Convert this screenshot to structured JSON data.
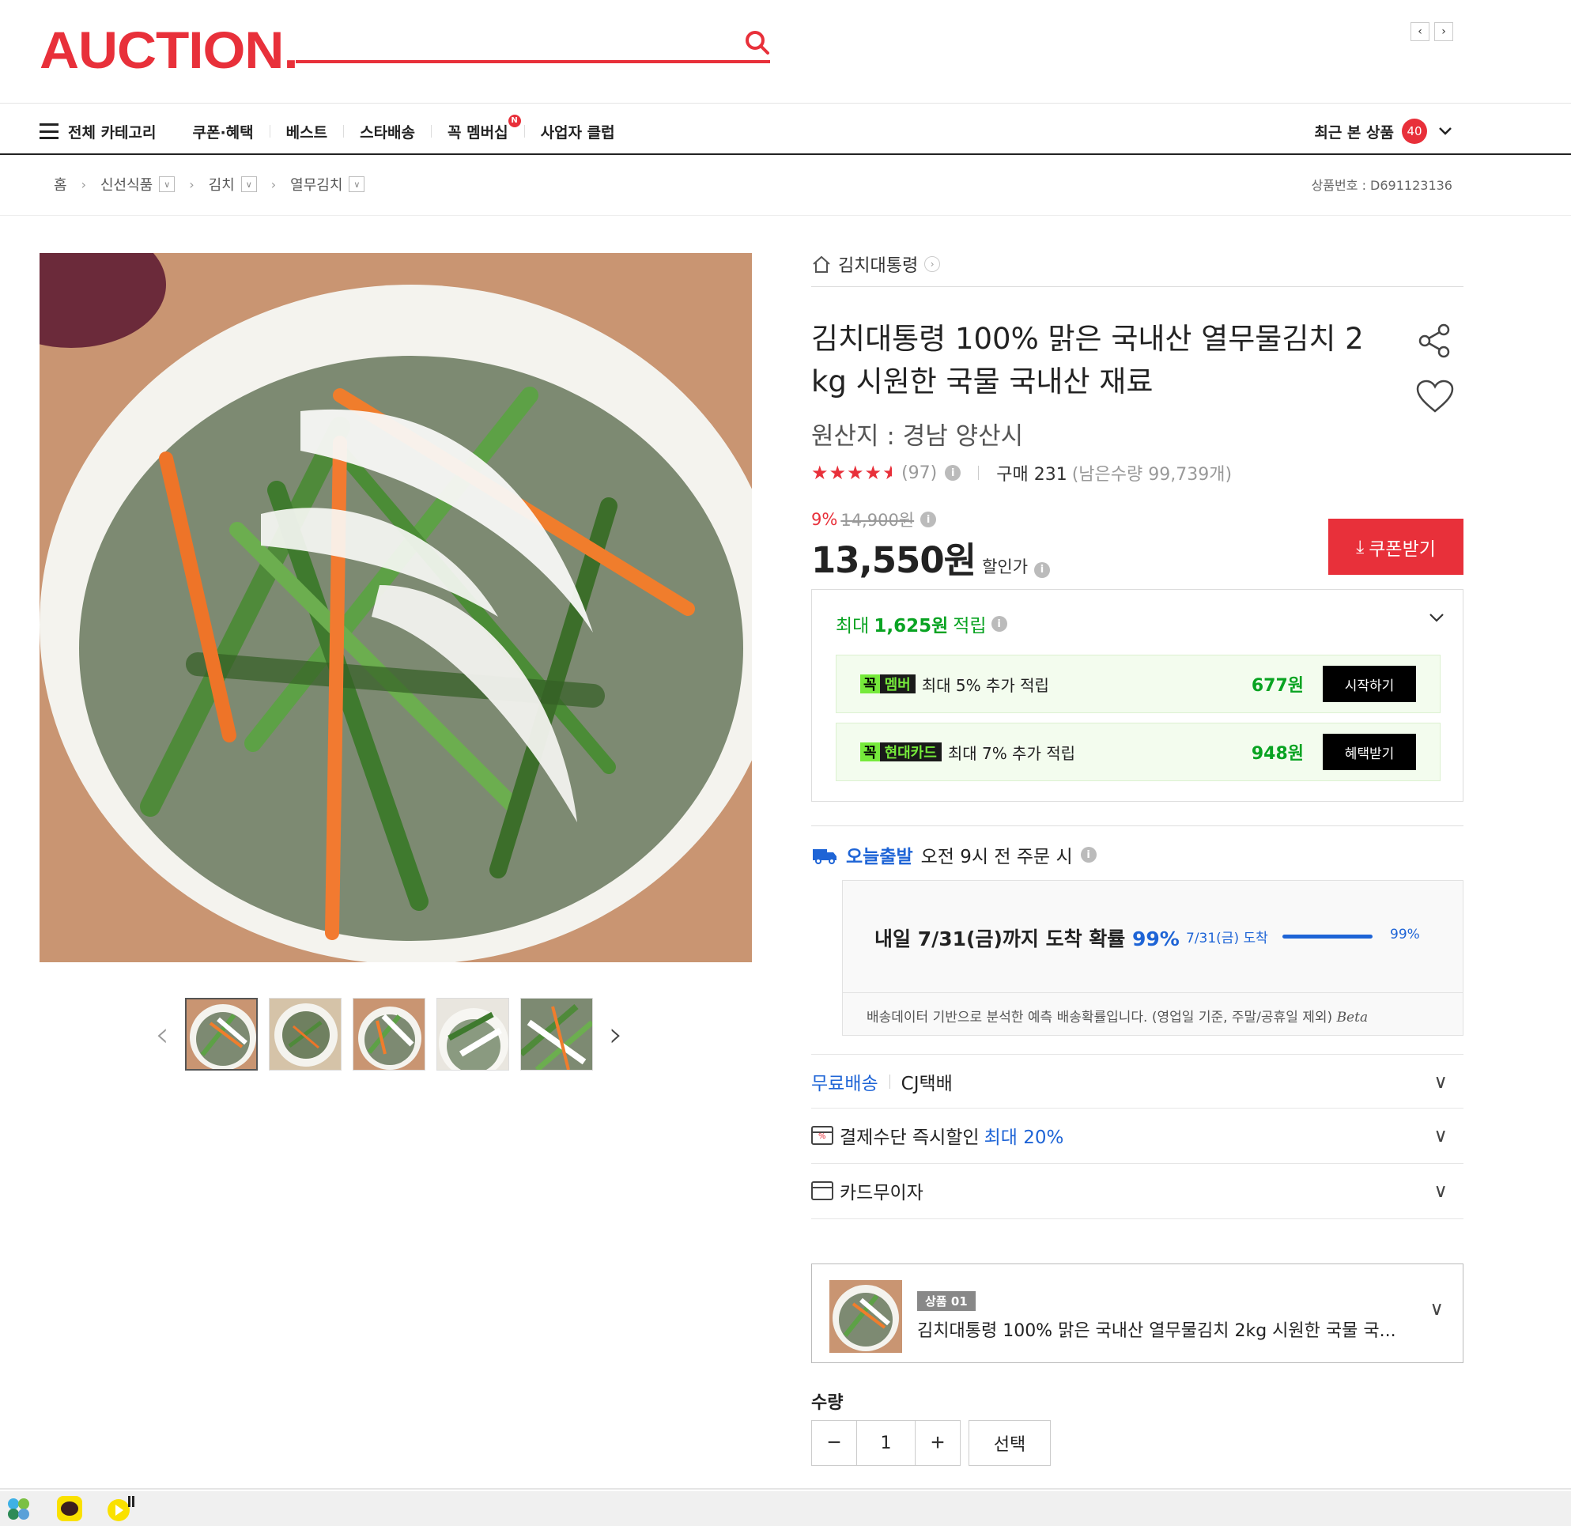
{
  "header": {
    "logo": "AUCTION.",
    "search_placeholder": ""
  },
  "nav": {
    "all_category": "전체 카테고리",
    "items": [
      "쿠폰·혜택",
      "베스트",
      "스타배송",
      "꼭 멤버십",
      "사업자 클럽"
    ],
    "membership_badge": "N",
    "recent_label": "최근 본 상품",
    "recent_count": "40"
  },
  "breadcrumb": {
    "home": "홈",
    "levels": [
      "신선식품",
      "김치",
      "열무김치"
    ],
    "product_no": "상품번호 : D691123136"
  },
  "product": {
    "store": "김치대통령",
    "title": "김치대통령 100% 맑은 국내산 열무물김치 2 kg 시원한 국물 국내산 재료",
    "origin": "원산지 : 경남 양산시",
    "rating_stars": 4.5,
    "review_count": "(97)",
    "purchase": "구매 231",
    "remaining": "(남은수량 99,739개)",
    "discount_pct": "9%",
    "original_price": "14,900원",
    "sale_price": "13,550원",
    "sale_label": "할인가",
    "coupon_button": "쿠폰받기"
  },
  "rewards": {
    "head_prefix": "최대",
    "head_amount": "1,625원",
    "head_suffix": "적립",
    "lines": [
      {
        "tag_k": "꼭",
        "tag_t": "멤버",
        "desc": "최대 5% 추가 적립",
        "points": "677원",
        "button": "시작하기"
      },
      {
        "tag_k": "꼭",
        "tag_t": "현대카드",
        "desc": "최대 7% 추가 적립",
        "points": "948원",
        "button": "혜택받기"
      }
    ]
  },
  "delivery": {
    "label": "오늘출발",
    "cutoff": "오전 9시 전 주문 시",
    "arrive_text": "내일 7/31(금)까지 도착 확률",
    "arrive_pct": "99%",
    "small_date": "7/31(금) 도착",
    "small_pct": "99%",
    "bar_fraction": 0.99,
    "note": "배송데이터 기반으로 분석한 예측 배송확률입니다. (영업일 기준, 주말/공휴일 제외)",
    "beta": "Beta"
  },
  "options": {
    "shipping_free": "무료배송",
    "shipping_carrier": "CJ택배",
    "payment_label": "결제수단 즉시할인",
    "payment_highlight": "최대 20%",
    "installment": "카드무이자"
  },
  "selection": {
    "tag": "상품 01",
    "name": "김치대통령 100% 맑은 국내산 열무물김치 2kg 시원한 국물 국...",
    "qty_label": "수량",
    "qty_value": "1",
    "select_button": "선택"
  },
  "colors": {
    "brand": "#e8303a",
    "green": "#09a322",
    "blue": "#1e64d6"
  }
}
